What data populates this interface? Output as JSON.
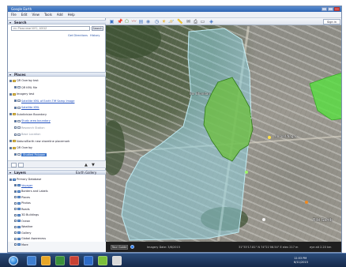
{
  "window": {
    "title": "Google Earth"
  },
  "menu": [
    "File",
    "Edit",
    "View",
    "Tools",
    "Add",
    "Help"
  ],
  "search": {
    "section_title": "Search",
    "input_placeholder": "ex: Pizza near NYC, 10012",
    "button_label": "Search",
    "links": [
      "Get Directions",
      "History"
    ]
  },
  "places": {
    "section_title": "Places",
    "items": [
      {
        "label": "QR Overlay test",
        "checked": true,
        "type": "folder",
        "style": "plain"
      },
      {
        "label": "QR KML file",
        "checked": true,
        "type": "item",
        "style": "plain"
      },
      {
        "label": "Imagery test",
        "checked": true,
        "type": "folder",
        "style": "plain"
      },
      {
        "label": "Satellite KML of Earth Tiff Samp Image",
        "checked": true,
        "type": "item",
        "style": "link"
      },
      {
        "label": "Satellite KML",
        "checked": true,
        "type": "item",
        "style": "link"
      },
      {
        "label": "Subdivision Boundary",
        "checked": true,
        "type": "folder",
        "style": "plain"
      },
      {
        "label": "Study area boundary",
        "checked": true,
        "type": "item",
        "style": "link"
      },
      {
        "label": "Research Station",
        "checked": false,
        "type": "item",
        "style": "muted"
      },
      {
        "label": "Base Location",
        "checked": false,
        "type": "item",
        "style": "muted"
      },
      {
        "label": "NaturalEarth new shoreline placemark",
        "checked": true,
        "type": "folder",
        "style": "plain"
      },
      {
        "label": "QR Overlay",
        "checked": true,
        "type": "folder",
        "style": "plain"
      },
      {
        "label": "Studied Polygon",
        "checked": true,
        "type": "item",
        "style": "selected"
      }
    ]
  },
  "layers": {
    "section_title": "Layers",
    "toolbar_label": "Earth Gallery",
    "items": [
      {
        "label": "Primary Database",
        "checked": true
      },
      {
        "label": "Voyager",
        "checked": true
      },
      {
        "label": "Borders and Labels",
        "checked": true
      },
      {
        "label": "Places",
        "checked": false
      },
      {
        "label": "Photos",
        "checked": false
      },
      {
        "label": "Roads",
        "checked": false
      },
      {
        "label": "3D Buildings",
        "checked": false
      },
      {
        "label": "Ocean",
        "checked": false
      },
      {
        "label": "Weather",
        "checked": false
      },
      {
        "label": "Gallery",
        "checked": false
      },
      {
        "label": "Global Awareness",
        "checked": false
      },
      {
        "label": "More",
        "checked": false
      }
    ]
  },
  "toolbar": {
    "sign_in_label": "Sign in"
  },
  "map": {
    "labels": [
      {
        "text": "Bor Bhandari"
      },
      {
        "text": "Ahmed Nagar"
      },
      {
        "text": "Bibi Sahib"
      }
    ],
    "colors": {
      "polygon_fill": "#8fd0dc",
      "green_polygon": "#6bbf3a",
      "bright_green": "#57e040"
    }
  },
  "status": {
    "tour_label": "Tour Guide",
    "imagery_text": "Imagery Date: 3/8/2015",
    "coords_text": "31°33'17.81\" N  74°21'06.54\" E  elev 217 m",
    "eye_text": "eye alt 2.20 km"
  },
  "taskbar": {
    "time": "12:53 PM",
    "date": "6/11/2015"
  }
}
